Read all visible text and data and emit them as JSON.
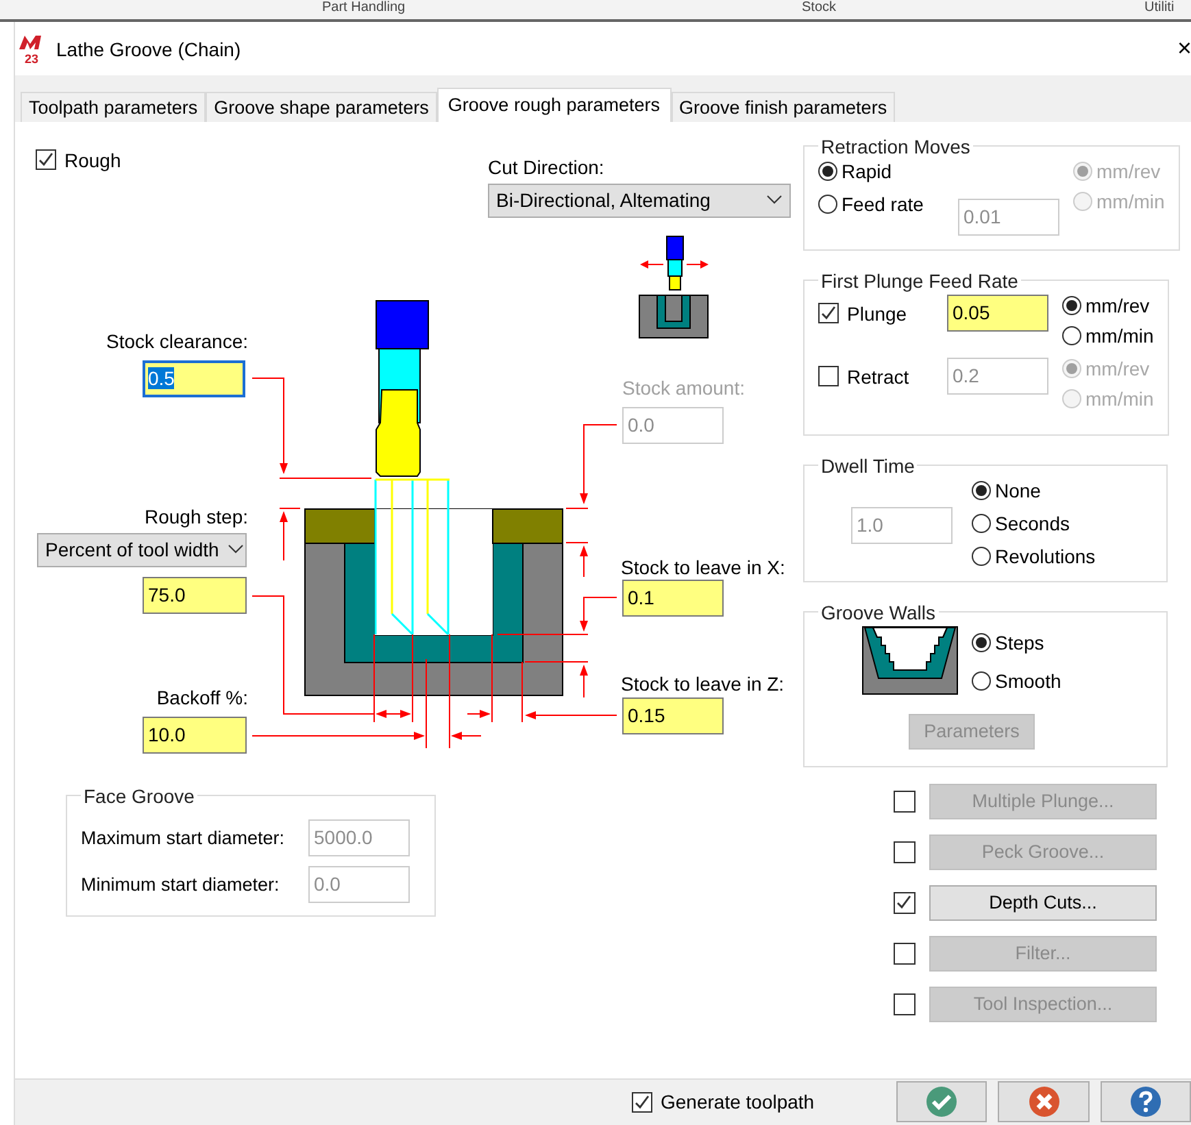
{
  "background_header": {
    "columns": [
      "Part Handling",
      "Stock",
      "Utiliti"
    ]
  },
  "window": {
    "logo_text": "23",
    "title": "Lathe Groove (Chain)",
    "close": "×"
  },
  "tabs": [
    {
      "label": "Toolpath parameters",
      "selected": false
    },
    {
      "label": "Groove shape parameters",
      "selected": false
    },
    {
      "label": "Groove rough parameters",
      "selected": true
    },
    {
      "label": "Groove finish parameters",
      "selected": false
    }
  ],
  "rough": {
    "label": "Rough",
    "checked": true
  },
  "cut_direction": {
    "label": "Cut Direction:",
    "value": "Bi-Directional, Altemating"
  },
  "stock_clearance": {
    "label": "Stock clearance:",
    "value": "0.5",
    "focused": true,
    "disabled": false
  },
  "stock_amount": {
    "label": "Stock amount:",
    "value": "0.0",
    "focused": false,
    "disabled": true
  },
  "rough_step": {
    "label": "Rough step:",
    "mode": "Percent of tool width",
    "value": "75.0",
    "focused": false,
    "disabled": false
  },
  "stock_to_leave_x": {
    "label": "Stock to leave in X:",
    "value": "0.1",
    "focused": false,
    "disabled": false
  },
  "backoff": {
    "label": "Backoff %:",
    "value": "10.0",
    "focused": false,
    "disabled": false
  },
  "stock_to_leave_z": {
    "label": "Stock to leave in Z:",
    "value": "0.15",
    "focused": false,
    "disabled": false
  },
  "face_groove": {
    "title": "Face Groove",
    "fields": [
      {
        "label": "Maximum start diameter:",
        "value": "5000.0",
        "disabled": true
      },
      {
        "label": "Minimum start diameter:",
        "value": "0.0",
        "disabled": true
      }
    ]
  },
  "retraction_moves": {
    "title": "Retraction Moves",
    "options": [
      {
        "label": "Rapid",
        "selected": true
      },
      {
        "label": "Feed rate",
        "selected": false
      }
    ],
    "feed_value": "0.01",
    "feed_disabled": true,
    "units": [
      {
        "label": "mm/rev",
        "selected": true,
        "disabled": true
      },
      {
        "label": "mm/min",
        "selected": false,
        "disabled": true
      }
    ]
  },
  "first_plunge_feed_rate": {
    "title": "First Plunge Feed Rate",
    "rows": [
      {
        "label": "Plunge",
        "checked": true,
        "value": "0.05",
        "disabled": false,
        "units": [
          {
            "label": "mm/rev",
            "selected": true
          },
          {
            "label": "mm/min",
            "selected": false
          }
        ]
      },
      {
        "label": "Retract",
        "checked": false,
        "value": "0.2",
        "disabled": true,
        "units": [
          {
            "label": "mm/rev",
            "selected": true
          },
          {
            "label": "mm/min",
            "selected": false
          }
        ]
      }
    ]
  },
  "dwell_time": {
    "title": "Dwell Time",
    "value": "1.0",
    "disabled": true,
    "options": [
      {
        "label": "None",
        "selected": true
      },
      {
        "label": "Seconds",
        "selected": false
      },
      {
        "label": "Revolutions",
        "selected": false
      }
    ]
  },
  "groove_walls": {
    "title": "Groove Walls",
    "options": [
      {
        "label": "Steps",
        "selected": true
      },
      {
        "label": "Smooth",
        "selected": false
      }
    ],
    "button": {
      "label": "Parameters",
      "disabled": true
    }
  },
  "options": [
    {
      "label": "Multiple Plunge...",
      "checked": false,
      "disabled": true
    },
    {
      "label": "Peck Groove...",
      "checked": false,
      "disabled": true
    },
    {
      "label": "Depth Cuts...",
      "checked": true,
      "disabled": false
    },
    {
      "label": "Filter...",
      "checked": false,
      "disabled": true
    },
    {
      "label": "Tool Inspection...",
      "checked": false,
      "disabled": true
    }
  ],
  "footer": {
    "generate_toolpath": {
      "label": "Generate toolpath",
      "checked": true
    },
    "buttons": [
      {
        "kind": "ok"
      },
      {
        "kind": "cancel"
      },
      {
        "kind": "help"
      }
    ]
  }
}
